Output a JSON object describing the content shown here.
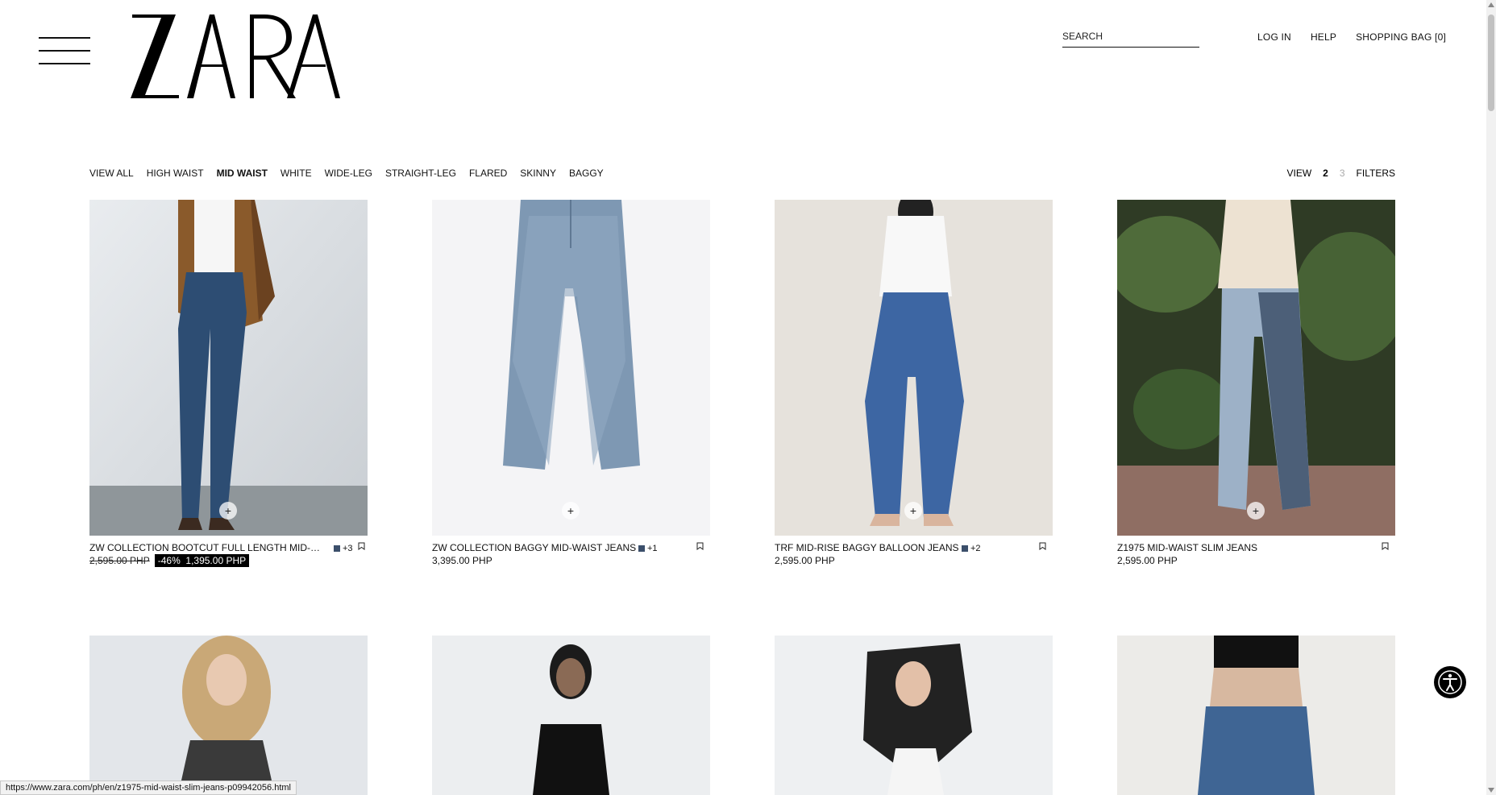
{
  "header": {
    "search_placeholder": "SEARCH",
    "login": "LOG IN",
    "help": "HELP",
    "bag": "SHOPPING BAG [0]"
  },
  "categories": [
    "VIEW ALL",
    "HIGH WAIST",
    "MID WAIST",
    "WHITE",
    "WIDE-LEG",
    "STRAIGHT-LEG",
    "FLARED",
    "SKINNY",
    "BAGGY"
  ],
  "active_category": "MID WAIST",
  "view": {
    "label": "VIEW",
    "option_2": "2",
    "option_3": "3",
    "filters": "FILTERS"
  },
  "products": [
    {
      "name": "ZW COLLECTION BOOTCUT FULL LENGTH MID-W...",
      "colors": "+3",
      "old_price": "2,595.00 PHP",
      "discount": "-46%",
      "price": "1,395.00 PHP"
    },
    {
      "name": "ZW COLLECTION BAGGY MID-WAIST JEANS",
      "colors": "+1",
      "price": "3,395.00 PHP"
    },
    {
      "name": "TRF MID-RISE BAGGY BALLOON JEANS",
      "colors": "+2",
      "price": "2,595.00 PHP"
    },
    {
      "name": "Z1975 MID-WAIST SLIM JEANS",
      "price": "2,595.00 PHP"
    }
  ],
  "status_url": "https://www.zara.com/ph/en/z1975-mid-waist-slim-jeans-p09942056.html",
  "icons": {
    "menu": "hamburger-icon",
    "bookmark": "bookmark-icon",
    "add": "plus-icon",
    "accessibility": "accessibility-icon"
  },
  "colors": {
    "text": "#111111",
    "swatch": "#3b4f6b",
    "sale_bg": "#000000"
  }
}
